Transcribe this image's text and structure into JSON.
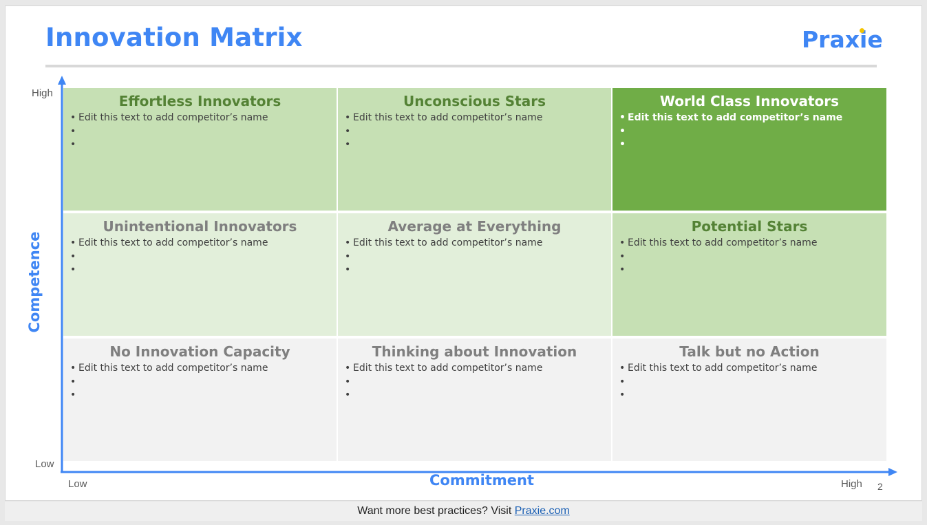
{
  "slide": {
    "title": "Innovation Matrix",
    "logo": "Praxie",
    "page_number": "2"
  },
  "axes": {
    "y_label": "Competence",
    "x_label": "Commitment",
    "y_high": "High",
    "y_low": "Low",
    "x_low": "Low",
    "x_high": "High",
    "color": "#3f86f4"
  },
  "cells": [
    {
      "title": "Effortless Innovators",
      "bg": "#c6e0b4",
      "title_color": "#548235",
      "text_color": "#404040",
      "bold_items": false,
      "items": [
        "Edit this text to add competitor’s name",
        "",
        ""
      ]
    },
    {
      "title": "Unconscious Stars",
      "bg": "#c6e0b4",
      "title_color": "#548235",
      "text_color": "#404040",
      "bold_items": false,
      "items": [
        "Edit this text to add competitor’s name",
        "",
        ""
      ]
    },
    {
      "title": "World Class Innovators",
      "bg": "#70ad47",
      "title_color": "#ffffff",
      "text_color": "#ffffff",
      "bold_items": true,
      "items": [
        "Edit this text to add competitor’s name",
        "",
        ""
      ]
    },
    {
      "title": "Unintentional Innovators",
      "bg": "#e2efda",
      "title_color": "#7f7f7f",
      "text_color": "#404040",
      "bold_items": false,
      "items": [
        "Edit this text to add competitor’s name",
        "",
        ""
      ]
    },
    {
      "title": "Average at Everything",
      "bg": "#e2efda",
      "title_color": "#7f7f7f",
      "text_color": "#404040",
      "bold_items": false,
      "items": [
        "Edit this text to add competitor’s name",
        "",
        ""
      ]
    },
    {
      "title": "Potential Stars",
      "bg": "#c6e0b4",
      "title_color": "#548235",
      "text_color": "#404040",
      "bold_items": false,
      "items": [
        "Edit this text to add competitor’s name",
        "",
        ""
      ]
    },
    {
      "title": "No Innovation Capacity",
      "bg": "#f2f2f2",
      "title_color": "#7f7f7f",
      "text_color": "#404040",
      "bold_items": false,
      "items": [
        "Edit this text to add competitor’s name",
        "",
        ""
      ]
    },
    {
      "title": "Thinking about Innovation",
      "bg": "#f2f2f2",
      "title_color": "#7f7f7f",
      "text_color": "#404040",
      "bold_items": false,
      "items": [
        "Edit this text to add competitor’s name",
        "",
        ""
      ]
    },
    {
      "title": "Talk but no Action",
      "bg": "#f2f2f2",
      "title_color": "#7f7f7f",
      "text_color": "#404040",
      "bold_items": false,
      "items": [
        "Edit this text to add competitor’s name",
        "",
        ""
      ]
    }
  ],
  "footer": {
    "text": "Want more best practices? Visit ",
    "link": "Praxie.com"
  }
}
